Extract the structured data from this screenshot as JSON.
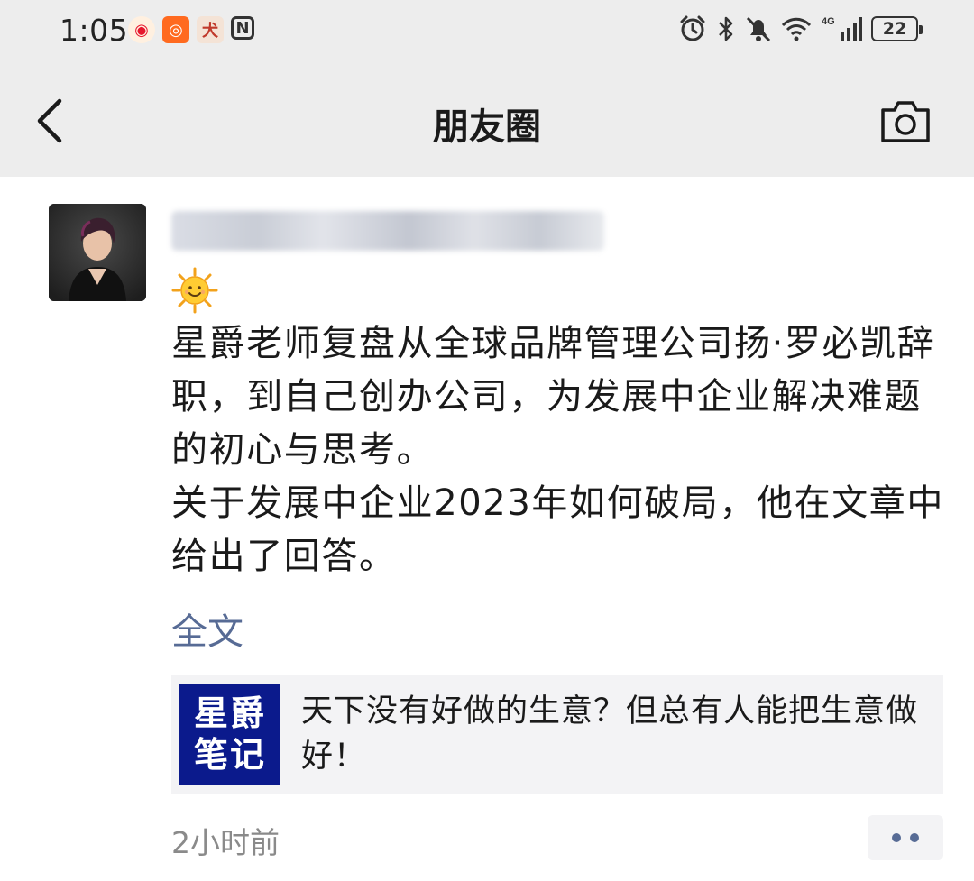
{
  "status_bar": {
    "time": "1:05",
    "apps": [
      "weibo-icon",
      "kuaishou-icon",
      "dog-app-icon",
      "nfc-icon"
    ],
    "app_glyphs": [
      "◉",
      "◎",
      "犬",
      "N"
    ],
    "network_label": "4G",
    "battery_level": "22"
  },
  "navbar": {
    "title": "朋友圈"
  },
  "post": {
    "author_name": "",
    "emoji": "sun-with-face-icon",
    "text_lines": [
      "星爵老师复盘从全球品牌管理公司扬·罗必凯辞职，到自己创办公司，为发展中企业解决难题的初心与思考。",
      "关于发展中企业2023年如何破局，他在文章中给出了回答。"
    ],
    "fulltext_link": "全文",
    "link_card": {
      "thumb_line1": "星爵",
      "thumb_line2": "笔记",
      "title": "天下没有好做的生意？但总有人能把生意做好！"
    },
    "time_ago": "2小时前"
  },
  "colors": {
    "link_blue": "#576b95",
    "header_bg": "#ededed",
    "card_bg": "#f3f3f5",
    "thumb_blue": "#0b1a8c"
  }
}
